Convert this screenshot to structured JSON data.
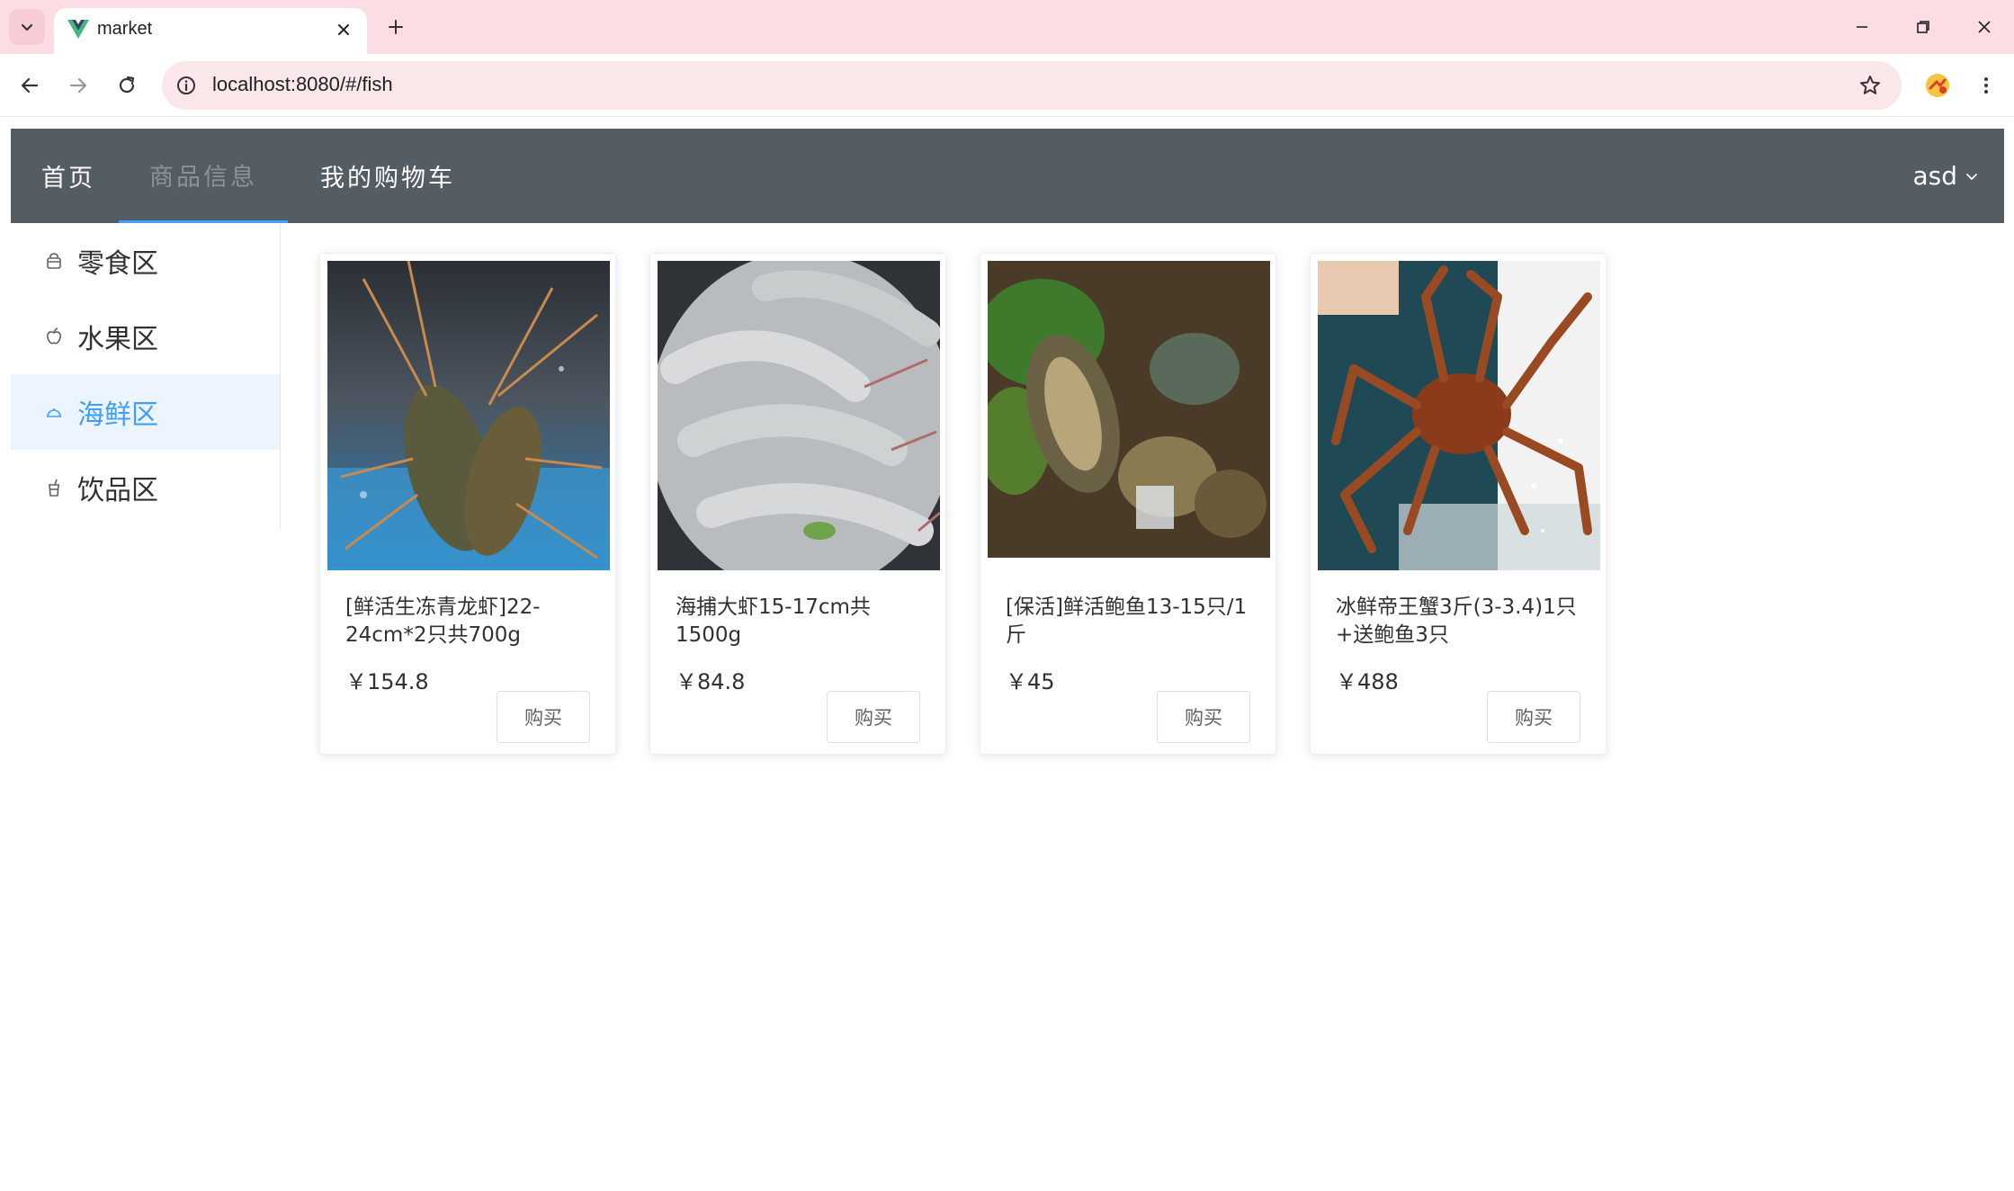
{
  "browser": {
    "tab_title": "market",
    "url": "localhost:8080/#/fish"
  },
  "app": {
    "nav": [
      "首页",
      "商品信息",
      "我的购物车"
    ],
    "active_nav": "商品信息",
    "user": "asd",
    "colors": {
      "header_bg": "#545c64",
      "accent": "#409eff"
    }
  },
  "sidebar": {
    "items": [
      {
        "label": "零食区",
        "icon": "basket-icon"
      },
      {
        "label": "水果区",
        "icon": "apple-icon"
      },
      {
        "label": "海鲜区",
        "icon": "dish-icon"
      },
      {
        "label": "饮品区",
        "icon": "drink-cup-icon"
      }
    ],
    "active": "海鲜区"
  },
  "products": [
    {
      "name": "[鲜活生冻青龙虾]22-24cm*2只共700g",
      "price": "￥154.8",
      "buy_label": "购买",
      "image": "lobster photo"
    },
    {
      "name": "海捕大虾15-17cm共1500g",
      "price": "￥84.8",
      "buy_label": "购买",
      "image": "shrimp photo"
    },
    {
      "name": "[保活]鲜活鲍鱼13-15只/1斤",
      "price": "￥45",
      "buy_label": "购买",
      "image": "abalone photo"
    },
    {
      "name": "冰鲜帝王蟹3斤(3-3.4)1只+送鲍鱼3只",
      "price": "￥488",
      "buy_label": "购买",
      "image": "king crab photo"
    }
  ]
}
